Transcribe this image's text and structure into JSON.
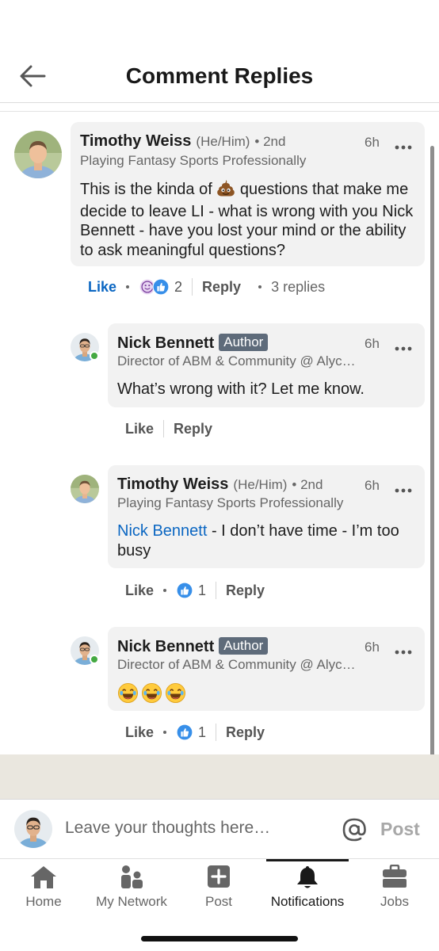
{
  "header": {
    "title": "Comment Replies"
  },
  "comments": [
    {
      "name": "Timothy Weiss",
      "pronouns": "(He/Him)",
      "degree": "• 2nd",
      "time": "6h",
      "headline": "Playing Fantasy Sports Professionally",
      "text_before_emoji": "This is the kinda of ",
      "emoji": "poop-emoji",
      "text_after_emoji": " questions that make me decide to leave LI - what is wrong with you Nick Bennett - have you lost your mind or the ability to ask meaningful questions?",
      "actions": {
        "like": "Like",
        "reaction_count": "2",
        "reply": "Reply",
        "replies": "3 replies"
      }
    },
    {
      "name": "Nick Bennett",
      "badge": "Author",
      "time": "6h",
      "headline": "Director of ABM & Community @ Alyc…",
      "text": "What’s wrong with it? Let me know.",
      "actions": {
        "like": "Like",
        "reply": "Reply"
      }
    },
    {
      "name": "Timothy Weiss",
      "pronouns": "(He/Him)",
      "degree": "• 2nd",
      "time": "6h",
      "headline": "Playing Fantasy Sports Professionally",
      "mention": "Nick Bennett",
      "text": " - I don’t have time - I’m too busy",
      "actions": {
        "like": "Like",
        "reaction_count": "1",
        "reply": "Reply"
      }
    },
    {
      "name": "Nick Bennett",
      "badge": "Author",
      "time": "6h",
      "headline": "Director of ABM & Community @ Alyc…",
      "emojis": [
        "laughing-emoji",
        "laughing-emoji",
        "laughing-emoji"
      ],
      "actions": {
        "like": "Like",
        "reaction_count": "1",
        "reply": "Reply"
      }
    }
  ],
  "compose": {
    "placeholder": "Leave your thoughts here…",
    "post_label": "Post"
  },
  "nav": {
    "items": [
      {
        "label": "Home",
        "icon": "home-icon"
      },
      {
        "label": "My Network",
        "icon": "network-icon"
      },
      {
        "label": "Post",
        "icon": "post-plus-icon"
      },
      {
        "label": "Notifications",
        "icon": "bell-icon",
        "active": true
      },
      {
        "label": "Jobs",
        "icon": "briefcase-icon"
      }
    ]
  },
  "colors": {
    "link_blue": "#0a66c2",
    "bubble_bg": "#f2f2f2",
    "badge_bg": "#5e6b7a",
    "online_green": "#44a942"
  }
}
